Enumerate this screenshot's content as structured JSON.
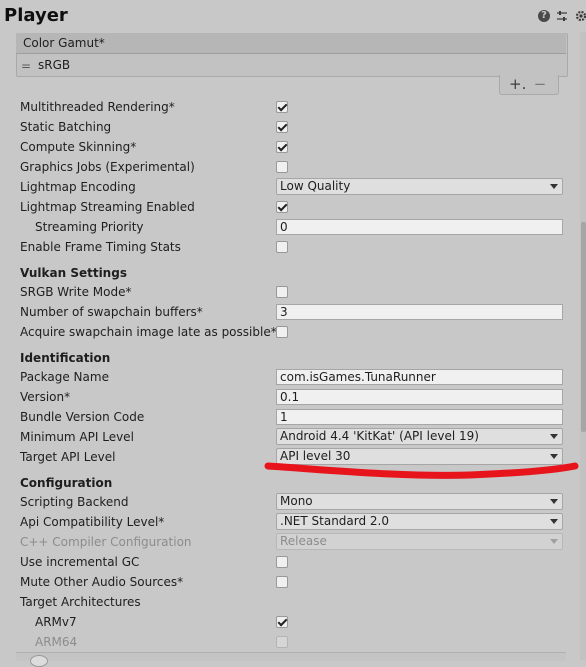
{
  "window": {
    "title": "Player"
  },
  "color_gamut": {
    "header": "Color Gamut*",
    "item": "sRGB",
    "drag_glyph": "=",
    "add_label": "+.",
    "remove_label": "−"
  },
  "rendering": {
    "multithreaded_rendering": {
      "label": "Multithreaded Rendering*",
      "checked": true
    },
    "static_batching": {
      "label": "Static Batching",
      "checked": true
    },
    "compute_skinning": {
      "label": "Compute Skinning*",
      "checked": true
    },
    "graphics_jobs": {
      "label": "Graphics Jobs (Experimental)",
      "checked": false
    },
    "lightmap_encoding": {
      "label": "Lightmap Encoding",
      "value": "Low Quality"
    },
    "lightmap_streaming": {
      "label": "Lightmap Streaming Enabled",
      "checked": true
    },
    "streaming_priority": {
      "label": "Streaming Priority",
      "value": "0"
    },
    "frame_timing": {
      "label": "Enable Frame Timing Stats",
      "checked": false
    }
  },
  "vulkan": {
    "header": "Vulkan Settings",
    "srgb_write": {
      "label": "SRGB Write Mode*",
      "checked": false
    },
    "swapchain_buffers": {
      "label": "Number of swapchain buffers*",
      "value": "3"
    },
    "acquire_late": {
      "label": "Acquire swapchain image late as possible*",
      "checked": false
    }
  },
  "identification": {
    "header": "Identification",
    "package_name": {
      "label": "Package Name",
      "value": "com.isGames.TunaRunner"
    },
    "version": {
      "label": "Version*",
      "value": "0.1"
    },
    "bundle_version_code": {
      "label": "Bundle Version Code",
      "value": "1"
    },
    "min_api": {
      "label": "Minimum API Level",
      "value": "Android 4.4 'KitKat' (API level 19)"
    },
    "target_api": {
      "label": "Target API Level",
      "value": "API level 30"
    }
  },
  "configuration": {
    "header": "Configuration",
    "scripting_backend": {
      "label": "Scripting Backend",
      "value": "Mono"
    },
    "api_compat": {
      "label": "Api Compatibility Level*",
      "value": ".NET Standard 2.0"
    },
    "cpp_compiler": {
      "label": "C++ Compiler Configuration",
      "value": "Release"
    },
    "incremental_gc": {
      "label": "Use incremental GC",
      "checked": false
    },
    "mute_audio": {
      "label": "Mute Other Audio Sources*",
      "checked": false
    },
    "target_arch": {
      "label": "Target Architectures"
    },
    "armv7": {
      "label": "ARMv7",
      "checked": true
    },
    "arm64": {
      "label": "ARM64",
      "checked": false
    }
  },
  "icons": [
    "help-icon",
    "sliders-icon",
    "gear-icon",
    "chevron-down-icon",
    "checkmark-icon",
    "drag-handle-icon"
  ],
  "colors": {
    "annotation_stroke": "#e8141c",
    "panel_bg": "#c8c8c8"
  }
}
